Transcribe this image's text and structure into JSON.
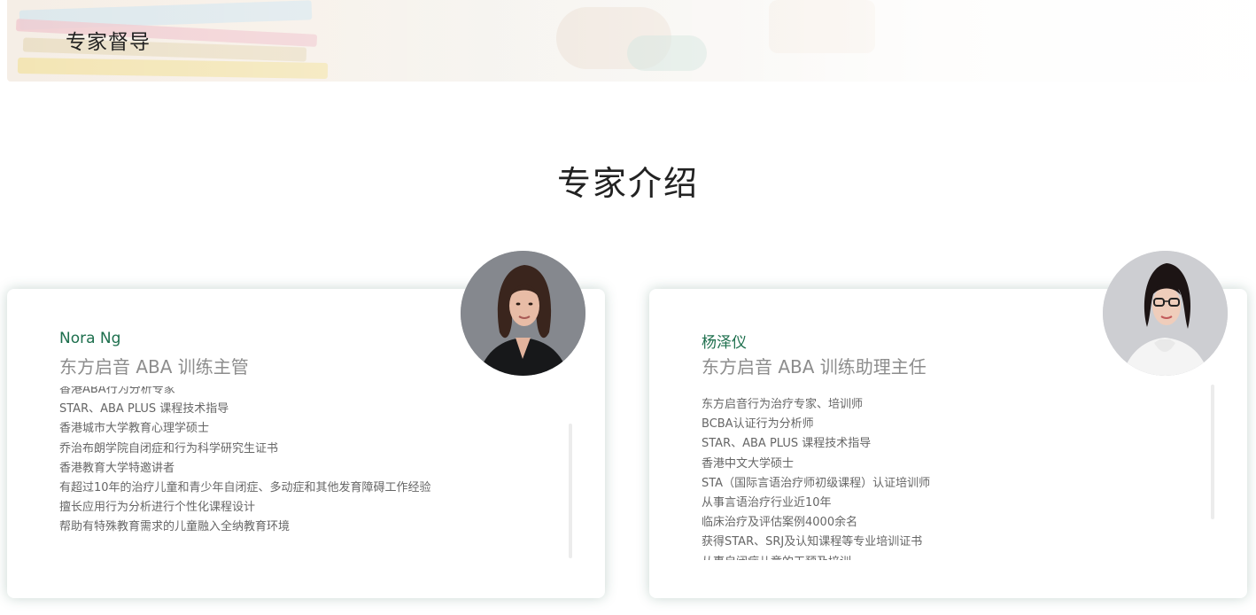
{
  "banner": {
    "title": "专家督导"
  },
  "section": {
    "title": "专家介绍"
  },
  "experts": [
    {
      "name": "Nora Ng",
      "role": "东方启音 ABA 训练主管",
      "items": [
        "香港ABA行为分析专家",
        "STAR、ABA PLUS 课程技术指导",
        "香港城市大学教育心理学硕士",
        "乔治布朗学院自闭症和行为科学研究生证书",
        "香港教育大学特邀讲者",
        "有超过10年的治疗儿童和青少年自闭症、多动症和其他发育障碍工作经验",
        "擅长应用行为分析进行个性化课程设计",
        "帮助有特殊教育需求的儿童融入全纳教育环境"
      ]
    },
    {
      "name": "杨泽仪",
      "role": "东方启音 ABA 训练助理主任",
      "items": [
        "东方启音行为治疗专家、培训师",
        "BCBA认证行为分析师",
        "STAR、ABA PLUS 课程技术指导",
        "香港中文大学硕士",
        "STA（国际言语治疗师初级课程）认证培训师",
        "从事言语治疗行业近10年",
        "临床治疗及评估案例4000余名",
        "获得STAR、SRJ及认知课程等专业培训证书",
        "从事自闭症儿童的干预及培训"
      ]
    }
  ],
  "colors": {
    "name": "#1d6f4d",
    "role": "#8d8d8d",
    "text": "#666666",
    "card_shadow": "#3c6e5f"
  }
}
